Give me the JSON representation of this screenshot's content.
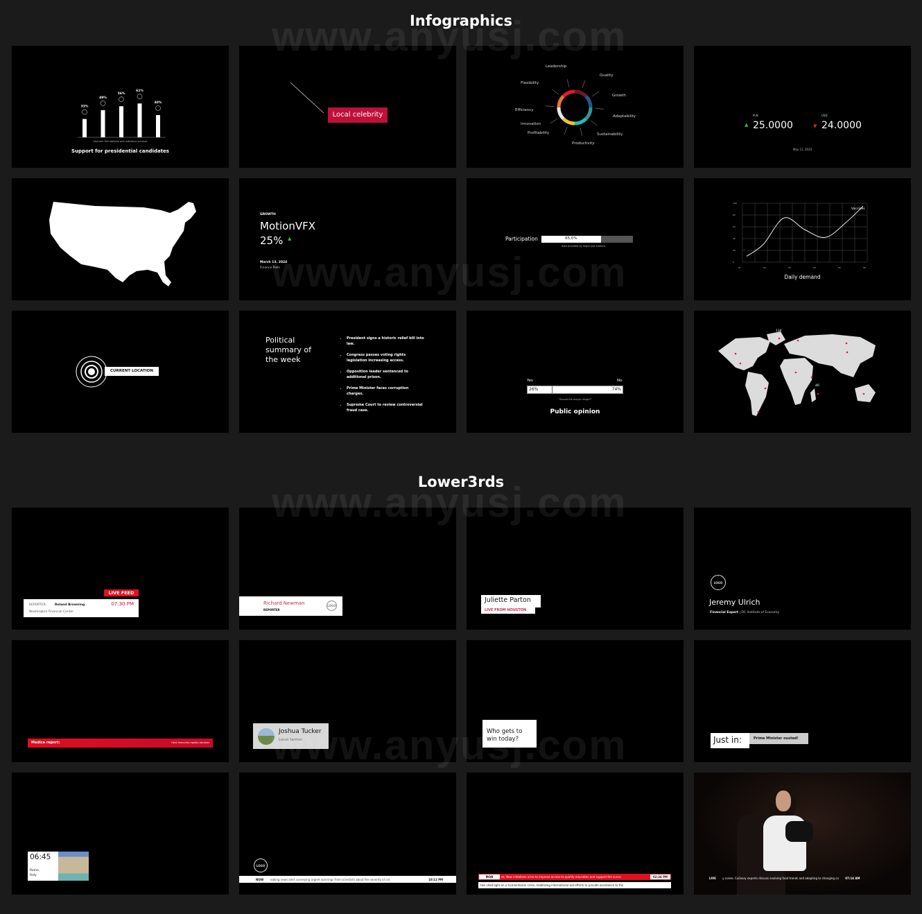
{
  "sections": {
    "infographics": "Infographics",
    "lower3rds": "Lower3rds"
  },
  "watermark": "www.anyusj.com",
  "colors": {
    "accent_red": "#d0102a",
    "background": "#1b1b1b",
    "tile": "#000000",
    "up": "#3cb043",
    "down": "#e0202a"
  },
  "chart_data": [
    {
      "type": "bar",
      "title": "Support for presidential candidates",
      "source": "Sources: Poll stations and individual surveys",
      "categories": [
        "1",
        "2",
        "3",
        "4",
        "5"
      ],
      "values": [
        33,
        49,
        56,
        61,
        40
      ],
      "labels": [
        "33%",
        "49%",
        "56%",
        "61%",
        "40%"
      ],
      "ylim": [
        0,
        100
      ]
    },
    {
      "type": "line",
      "title": "Daily demand",
      "series": [
        {
          "name": "Vaccines",
          "x": [
            0.2,
            1,
            2,
            3,
            4,
            5,
            5.8
          ],
          "y": [
            10,
            30,
            75,
            55,
            42,
            68,
            95
          ]
        }
      ],
      "yticks": [
        "0",
        "20",
        "40",
        "60",
        "80",
        "100"
      ],
      "xticks": [
        "01",
        "02",
        "03",
        "04",
        "05",
        "06"
      ],
      "ylim": [
        0,
        100
      ],
      "xlim": [
        0,
        6
      ],
      "grid": true
    }
  ],
  "callout": {
    "label": "Local celebrity"
  },
  "donut": {
    "labels": [
      "Leadership",
      "Quality",
      "Flexibility",
      "Growth",
      "Efficiency",
      "Adaptability",
      "Innovation",
      "Profitability",
      "Sustainability",
      "Productivity"
    ],
    "colors": [
      "#6b1a22",
      "#1e5c8c",
      "#3a8fa0",
      "#19c0b8",
      "#f0c419",
      "#e8e8e8",
      "#e8782a",
      "#e01c24"
    ]
  },
  "currency": {
    "a_code": "PLN",
    "a_value": "25.0000",
    "a_dir": "up",
    "b_code": "USD",
    "b_value": "24.0000",
    "b_dir": "down",
    "date": "May 11, 2024"
  },
  "growth": {
    "kicker": "GROWTH",
    "company": "MotionVFX",
    "value": "25%",
    "date": "March 13, 2024",
    "source": "Finance Polls"
  },
  "participation": {
    "label": "Participation",
    "percent": 65,
    "value_text": "65,0%",
    "note": "data provided by major poll stations"
  },
  "location": {
    "label": "CURRENT LOCATION"
  },
  "political": {
    "title": "Political summary of the week",
    "items": [
      "President signs a historic relief bill into law.",
      "Congress passes voting rights legislation increasing access.",
      "Opposition leader sentenced to additional prison.",
      "Prime Minister faces corruption charges.",
      "Supreme Court to review controversial fraud case."
    ]
  },
  "opinion": {
    "yes_label": "Yes",
    "no_label": "No",
    "yes_pct": 26,
    "no_pct": 74,
    "yes_text": "26%",
    "no_text": "74%",
    "question": "\"Should the mayor resign?\"",
    "title": "Public opinion"
  },
  "worldmap": {
    "values": [
      "134",
      "46"
    ]
  },
  "lower": {
    "livefeed": {
      "badge": "LIVE FEED",
      "role": "REPORTER:",
      "name": "Roland Browning",
      "time": "07:30 PM",
      "place": "Washington Financial Center"
    },
    "newman": {
      "name": "Richard Newman",
      "role": "REPORTER",
      "logo": "LOGO"
    },
    "parton": {
      "name": "Juliette Parton",
      "sub": "LIVE FROM HOUSTON"
    },
    "ulrich": {
      "logo": "LOGO",
      "name": "Jeremy Ulrich",
      "role": "Financial Expert",
      "org": "| DC Institute of Economy"
    },
    "medica": {
      "left": "Medica report:",
      "right": "Herd immunity rapidly declines"
    },
    "tucker": {
      "name": "Joshua Tucker",
      "role": "Local farmer"
    },
    "question": {
      "text": "Who gets to win today?"
    },
    "justin": {
      "label": "Just in:",
      "text": "Prime Minister ousted!"
    },
    "clock": {
      "time": "06:45",
      "place1": "Rome,",
      "place2": "Italy"
    },
    "now": {
      "logo": "LOGO",
      "tag": "NOW",
      "text": "eaking news alert conveying urgent warnings from scientists about the severity of clir",
      "time": "10:12 PM"
    },
    "mon": {
      "tag": "MON",
      "text": "es. New initiatives arise to improve access to quality education and support the succe",
      "time": "02:34 PM",
      "text2": "ties shed light on a humanitarian crisis, mobilizing international aid efforts to provide assistance to the"
    },
    "live": {
      "tag": "LIVE",
      "text": "y scene. Culinary experts discuss evolving food trends and adapting to changing co",
      "time": "07:14 AM"
    }
  }
}
